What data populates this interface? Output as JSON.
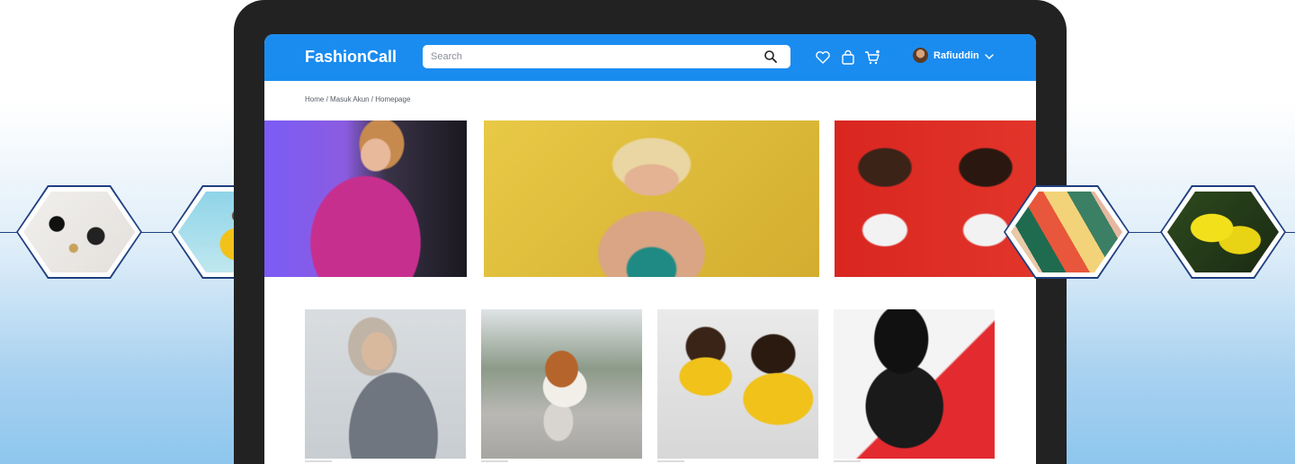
{
  "navbar": {
    "brand": "FashionCall",
    "search_placeholder": "Search",
    "user_name": "Rafiuddin",
    "icons": [
      "heart-icon",
      "bag-icon",
      "cart-icon",
      "chevron-down-icon"
    ]
  },
  "breadcrumb": "Home / Masuk Akun / Homepage",
  "banners": [
    {
      "name": "woman-pink-sweater-neon",
      "colors": [
        "#8b5cf6",
        "#c2348c"
      ]
    },
    {
      "name": "woman-sunglasses-yellow-wall",
      "colors": [
        "#e5c13e",
        "#c9a436"
      ]
    },
    {
      "name": "two-women-high-five-red-wall",
      "colors": [
        "#d7261e",
        "#2b1a14"
      ]
    }
  ],
  "products": [
    {
      "name": "woman-grey-shirt"
    },
    {
      "name": "woman-striped-sweater-beach"
    },
    {
      "name": "two-women-yellow-sportswear"
    },
    {
      "name": "woman-black-hat-coat"
    }
  ],
  "hexagons": [
    {
      "name": "accessories-flatlay"
    },
    {
      "name": "woman-yellow-outfit"
    },
    {
      "name": "abstract-colorful-shapes"
    },
    {
      "name": "yellow-sneakers"
    }
  ],
  "colors": {
    "primary": "#1a8cf0",
    "hex_border": "#1f3f80",
    "device": "#222222"
  }
}
